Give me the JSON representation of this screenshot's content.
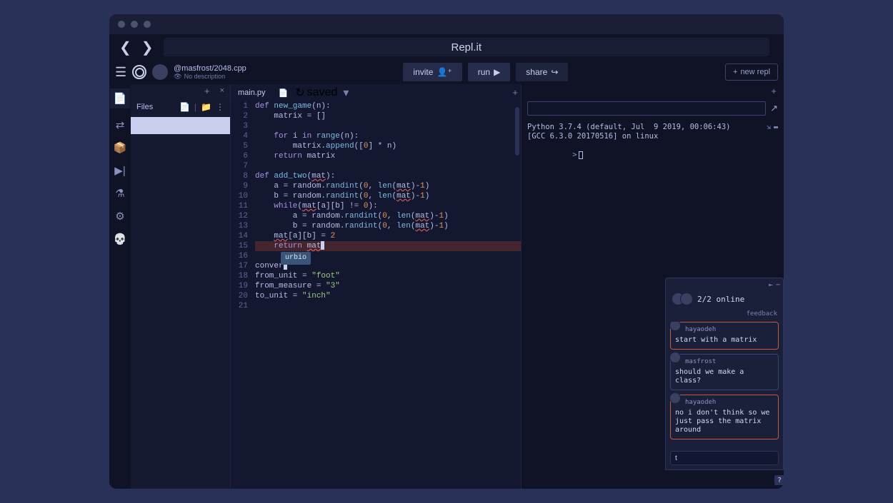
{
  "urlbar": {
    "text": "Repl.it"
  },
  "user": {
    "handle": "@masfrost/2048.cpp",
    "subtitle": "No description"
  },
  "header": {
    "invite": "invite",
    "run": "run",
    "share": "share",
    "new_repl": "new repl"
  },
  "files_panel": {
    "title": "Files"
  },
  "tabs": {
    "file": "main.py",
    "saved": "saved"
  },
  "code_lines": [
    {
      "n": 1,
      "segs": [
        [
          "kw",
          "def "
        ],
        [
          "fn",
          "new_game"
        ],
        [
          "id",
          "(n):"
        ]
      ]
    },
    {
      "n": 2,
      "segs": [
        [
          "id",
          "    matrix = []"
        ]
      ]
    },
    {
      "n": 3,
      "segs": []
    },
    {
      "n": 4,
      "segs": [
        [
          "id",
          "    "
        ],
        [
          "kw",
          "for"
        ],
        [
          "id",
          " i "
        ],
        [
          "kw",
          "in"
        ],
        [
          "id",
          " "
        ],
        [
          "fn",
          "range"
        ],
        [
          "id",
          "(n):"
        ]
      ]
    },
    {
      "n": 5,
      "segs": [
        [
          "id",
          "        matrix."
        ],
        [
          "fn",
          "append"
        ],
        [
          "id",
          "(["
        ],
        [
          "num",
          "0"
        ],
        [
          "id",
          "] * n)"
        ]
      ]
    },
    {
      "n": 6,
      "segs": [
        [
          "id",
          "    "
        ],
        [
          "kw",
          "return"
        ],
        [
          "id",
          " matrix"
        ]
      ]
    },
    {
      "n": 7,
      "segs": []
    },
    {
      "n": 8,
      "segs": [
        [
          "kw",
          "def "
        ],
        [
          "fn",
          "add_two"
        ],
        [
          "id",
          "("
        ],
        [
          "err",
          "mat"
        ],
        [
          "id",
          "):"
        ]
      ]
    },
    {
      "n": 9,
      "segs": [
        [
          "id",
          "    a = random."
        ],
        [
          "fn",
          "randint"
        ],
        [
          "id",
          "("
        ],
        [
          "num",
          "0"
        ],
        [
          "id",
          ", "
        ],
        [
          "fn",
          "len"
        ],
        [
          "id",
          "("
        ],
        [
          "err",
          "mat"
        ],
        [
          "id",
          ")-"
        ],
        [
          "num",
          "1"
        ],
        [
          "id",
          ")"
        ]
      ]
    },
    {
      "n": 10,
      "segs": [
        [
          "id",
          "    b = random."
        ],
        [
          "fn",
          "randint"
        ],
        [
          "id",
          "("
        ],
        [
          "num",
          "0"
        ],
        [
          "id",
          ", "
        ],
        [
          "fn",
          "len"
        ],
        [
          "id",
          "("
        ],
        [
          "err",
          "mat"
        ],
        [
          "id",
          ")-"
        ],
        [
          "num",
          "1"
        ],
        [
          "id",
          ")"
        ]
      ]
    },
    {
      "n": 11,
      "segs": [
        [
          "id",
          "    "
        ],
        [
          "kw",
          "while"
        ],
        [
          "id",
          "("
        ],
        [
          "err",
          "mat"
        ],
        [
          "id",
          "[a][b] != "
        ],
        [
          "num",
          "0"
        ],
        [
          "id",
          "):"
        ]
      ]
    },
    {
      "n": 12,
      "segs": [
        [
          "id",
          "        a = random."
        ],
        [
          "fn",
          "randint"
        ],
        [
          "id",
          "("
        ],
        [
          "num",
          "0"
        ],
        [
          "id",
          ", "
        ],
        [
          "fn",
          "len"
        ],
        [
          "id",
          "("
        ],
        [
          "err",
          "mat"
        ],
        [
          "id",
          ")-"
        ],
        [
          "num",
          "1"
        ],
        [
          "id",
          ")"
        ]
      ]
    },
    {
      "n": 13,
      "segs": [
        [
          "id",
          "        b = random."
        ],
        [
          "fn",
          "randint"
        ],
        [
          "id",
          "("
        ],
        [
          "num",
          "0"
        ],
        [
          "id",
          ", "
        ],
        [
          "fn",
          "len"
        ],
        [
          "id",
          "("
        ],
        [
          "err",
          "mat"
        ],
        [
          "id",
          ")-"
        ],
        [
          "num",
          "1"
        ],
        [
          "id",
          ")"
        ]
      ]
    },
    {
      "n": 14,
      "segs": [
        [
          "id",
          "    "
        ],
        [
          "err",
          "mat"
        ],
        [
          "id",
          "[a][b] = "
        ],
        [
          "num",
          "2"
        ]
      ]
    },
    {
      "n": 15,
      "hl": true,
      "segs": [
        [
          "id",
          "    "
        ],
        [
          "kw",
          "return"
        ],
        [
          "id",
          " "
        ],
        [
          "err",
          "mat"
        ]
      ],
      "cursor": true
    },
    {
      "n": 16,
      "segs": []
    },
    {
      "n": 17,
      "segs": [
        [
          "id",
          "conver"
        ]
      ],
      "cursor": true
    },
    {
      "n": 18,
      "segs": [
        [
          "id",
          "from_unit = "
        ],
        [
          "str",
          "\"foot\""
        ]
      ]
    },
    {
      "n": 19,
      "segs": [
        [
          "id",
          "from_measure = "
        ],
        [
          "str",
          "\"3\""
        ]
      ]
    },
    {
      "n": 20,
      "segs": [
        [
          "id",
          "to_unit = "
        ],
        [
          "str",
          "\"inch\""
        ]
      ]
    },
    {
      "n": 21,
      "segs": []
    }
  ],
  "autocomplete": {
    "text": "urbio",
    "line": 15
  },
  "terminal": {
    "line1": "Python 3.7.4 (default, Jul  9 2019, 00:06:43)",
    "line2": "[GCC 6.3.0 20170516] on linux",
    "prompt": ">"
  },
  "chat": {
    "online_count": "2/2 online",
    "feedback": "feedback",
    "messages": [
      {
        "user": "hayaodeh",
        "text": "start with a matrix",
        "cls": "reply"
      },
      {
        "user": "masfrost",
        "text": "should we make a class?",
        "cls": ""
      },
      {
        "user": "hayaodeh",
        "text": "no i don't think so we just pass the matrix around",
        "cls": "reply2"
      }
    ],
    "input_value": "t"
  }
}
